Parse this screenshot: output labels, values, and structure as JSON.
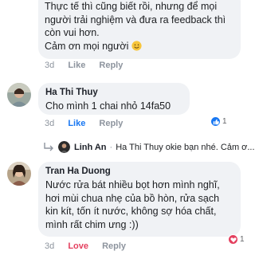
{
  "comment1": {
    "lines": [
      "Thực tế thì cũng biết rồi, nhưng để mọi",
      "người trải nghiệm và đưa ra feedback thì",
      "còn vui hơn.",
      "Cảm ơn mọi người"
    ],
    "emoji": "smiling-face",
    "actions": {
      "time": "3d",
      "like": "Like",
      "reply": "Reply"
    }
  },
  "comment2": {
    "author": "Ha Thi Thuy",
    "text": "Cho mình 1 chai nhỏ 14fa50",
    "actions": {
      "time": "3d",
      "like": "Like",
      "reply": "Reply"
    },
    "reaction": {
      "type": "like",
      "count": "1",
      "color": "#1877f2"
    },
    "reply_preview": {
      "author": "Linh An",
      "text": "Ha Thi Thuy okie bạn nhé. Cảm ơ..."
    }
  },
  "comment3": {
    "author": "Tran Ha Duong",
    "lines": [
      "Nước rửa bát nhiều bọt hơn mình nghĩ,",
      "hơi mùi chua nhẹ của bồ hòn, rửa sạch",
      "kin kít, tốn ít nước, không sợ hóa chất,",
      "mình rất chim ưng :))"
    ],
    "actions": {
      "time": "3d",
      "like": "Love",
      "reply": "Reply"
    },
    "reaction": {
      "type": "love",
      "count": "1",
      "color": "#e4405f"
    }
  },
  "colors": {
    "bubble": "#f0f2f5",
    "like_blue": "#1877f2",
    "love_red": "#e4405f",
    "muted": "#8d949e"
  }
}
